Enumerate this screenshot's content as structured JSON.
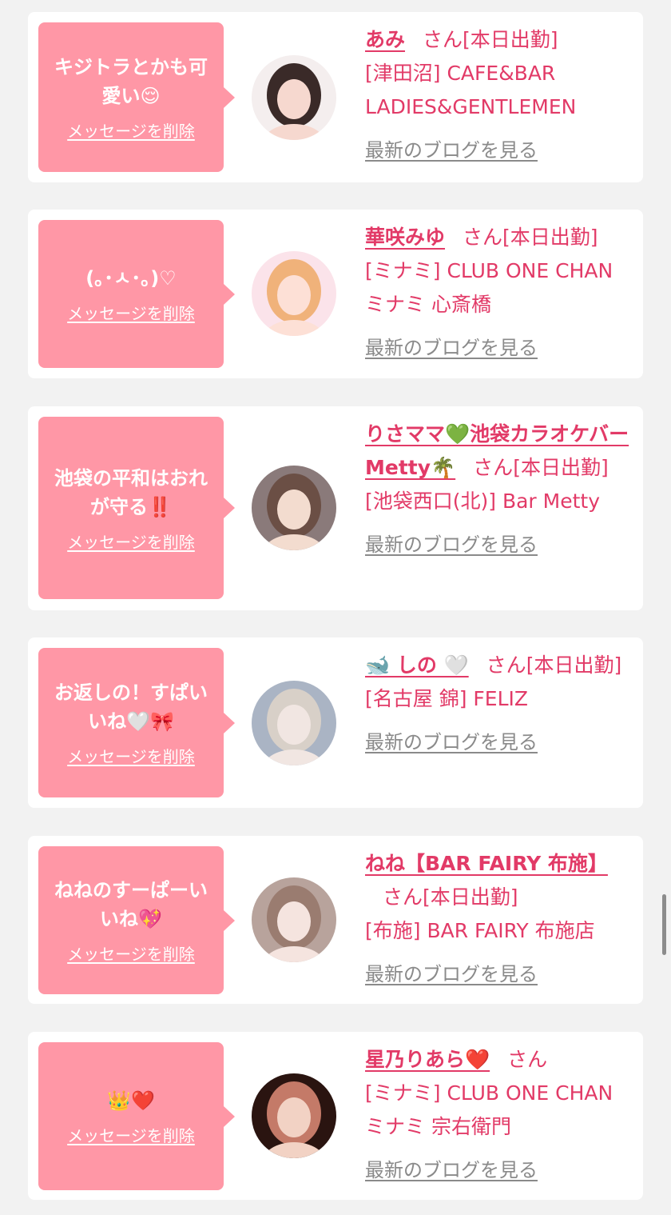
{
  "delete_label": "メッセージを削除",
  "blog_label": "最新のブログを見る",
  "san_suffix": "さん",
  "cards": [
    {
      "message": "キジトラとかも可愛い😌",
      "name": "あみ",
      "status": "[本日出勤]",
      "shop": "[津田沼] CAFE&BAR LADIES&GENTLEMEN",
      "avatar_palette": [
        "#f4eeee",
        "#3a2a28",
        "#f6d8cf"
      ]
    },
    {
      "message": "(｡･ㅅ･｡)♡",
      "name": "華咲みゆ",
      "status": "[本日出勤]",
      "shop": "[ミナミ] CLUB ONE CHAN ミナミ 心斎橋",
      "avatar_palette": [
        "#fbe3ea",
        "#f0b27a",
        "#fde0d6"
      ]
    },
    {
      "message": "池袋の平和はおれが守る‼️",
      "name": "りさママ💚池袋カラオケバーMetty🌴",
      "status": "[本日出勤]",
      "shop": "[池袋西口(北)] Bar Metty",
      "avatar_palette": [
        "#8a7a7a",
        "#6b4f45",
        "#f3dccf"
      ]
    },
    {
      "message": "お返しの！すぱいいね🤍🎀",
      "name": "🐋 しの 🤍",
      "status": "[本日出勤]",
      "shop": "[名古屋 錦] FELIZ",
      "avatar_palette": [
        "#aab4c4",
        "#d8d0c8",
        "#f1e6e2"
      ]
    },
    {
      "message": "ねねのすーぱーいいね💖",
      "name": "ねね【BAR FAIRY 布施】",
      "status": "[本日出勤]",
      "shop": "[布施] BAR FAIRY 布施店",
      "avatar_palette": [
        "#b8a39c",
        "#9a7c70",
        "#f5e4df"
      ]
    },
    {
      "message": "👑❤️",
      "name": "星乃りあら❤️",
      "status": "",
      "shop": "[ミナミ] CLUB ONE CHAN ミナミ 宗右衛門",
      "avatar_palette": [
        "#2a1410",
        "#c47a68",
        "#f2d2c4"
      ]
    }
  ]
}
